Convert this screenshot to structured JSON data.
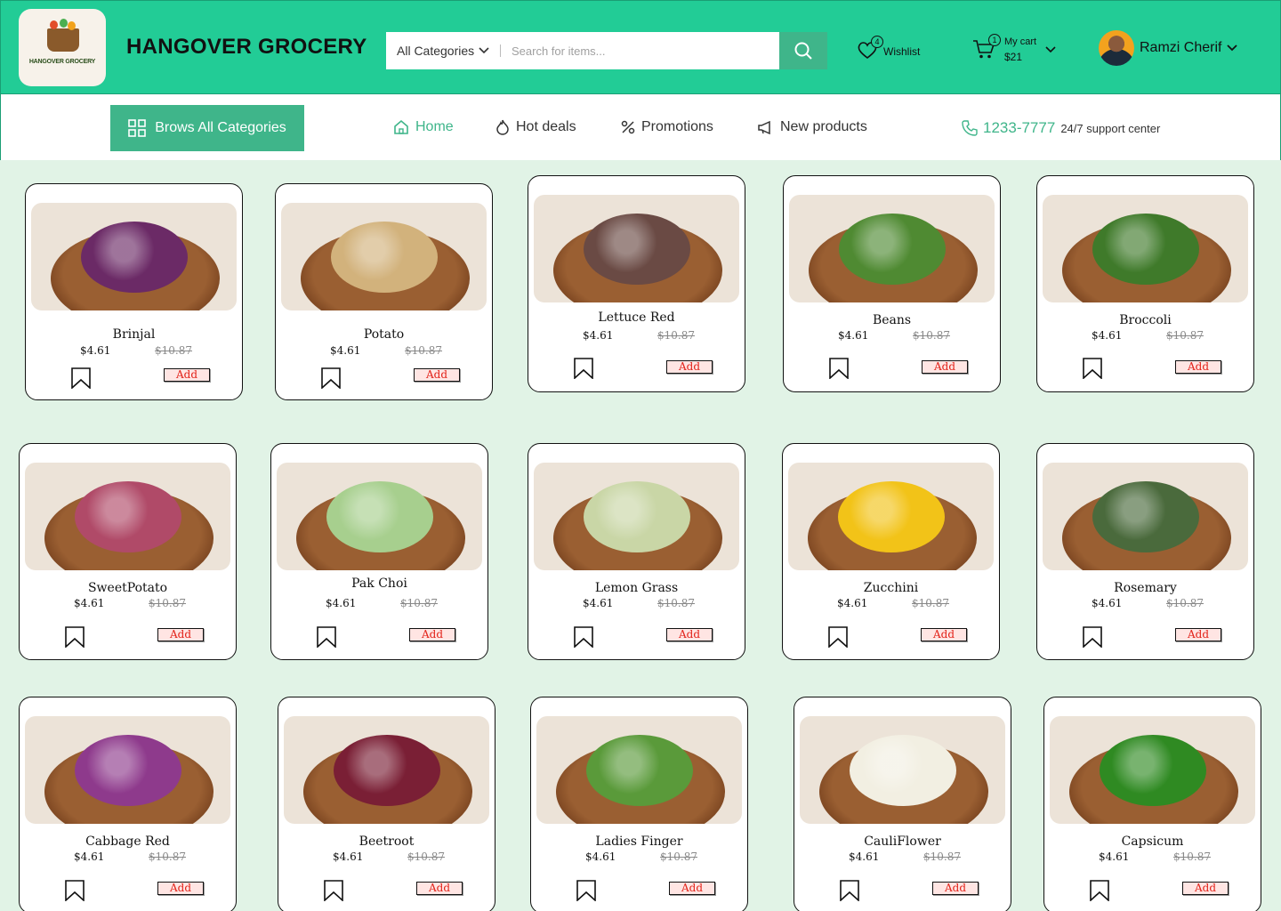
{
  "header": {
    "logo_text": "HANGOVER GROCERY",
    "brand": "HANGOVER GROCERY",
    "search": {
      "category": "All Categories",
      "placeholder": "Search for items..."
    },
    "wishlist": {
      "label": "Wishlist",
      "count": "4"
    },
    "cart": {
      "label": "My cart",
      "total": "$21",
      "count": "1"
    },
    "user": {
      "name": "Ramzi Cherif"
    }
  },
  "nav": {
    "browse": "Brows All Categories",
    "items": [
      "Home",
      "Hot deals",
      "Promotions",
      "New products"
    ],
    "phone": "1233-7777",
    "support": "24/7 support center"
  },
  "colors": {
    "primary": "#22cc96",
    "accent": "#3fb58a",
    "background": "#e1f3e6",
    "add_text": "#e2231a"
  },
  "products": [
    {
      "name": "Brinjal",
      "price": "$4.61",
      "old_price": "$10.87",
      "add": "Add",
      "color": "#6b2a66"
    },
    {
      "name": "Potato",
      "price": "$4.61",
      "old_price": "$10.87",
      "add": "Add",
      "color": "#d2b27c"
    },
    {
      "name": "Lettuce Red",
      "price": "$4.61",
      "old_price": "$10.87",
      "add": "Add",
      "color": "#6a4a44"
    },
    {
      "name": "Beans",
      "price": "$4.61",
      "old_price": "$10.87",
      "add": "Add",
      "color": "#4f8a32"
    },
    {
      "name": "Broccoli",
      "price": "$4.61",
      "old_price": "$10.87",
      "add": "Add",
      "color": "#3f7a2a"
    },
    {
      "name": "SweetPotato",
      "price": "$4.61",
      "old_price": "$10.87",
      "add": "Add",
      "color": "#b04a68"
    },
    {
      "name": "Pak Choi",
      "price": "$4.61",
      "old_price": "$10.87",
      "add": "Add",
      "color": "#a7cf8e"
    },
    {
      "name": "Lemon Grass",
      "price": "$4.61",
      "old_price": "$10.87",
      "add": "Add",
      "color": "#c9d6a6"
    },
    {
      "name": "Zucchini",
      "price": "$4.61",
      "old_price": "$10.87",
      "add": "Add",
      "color": "#f2c318"
    },
    {
      "name": "Rosemary",
      "price": "$4.61",
      "old_price": "$10.87",
      "add": "Add",
      "color": "#4a6a3c"
    },
    {
      "name": "Cabbage Red",
      "price": "$4.61",
      "old_price": "$10.87",
      "add": "Add",
      "color": "#8e3a8c"
    },
    {
      "name": "Beetroot",
      "price": "$4.61",
      "old_price": "$10.87",
      "add": "Add",
      "color": "#7a1f35"
    },
    {
      "name": "Ladies Finger",
      "price": "$4.61",
      "old_price": "$10.87",
      "add": "Add",
      "color": "#5a9a3a"
    },
    {
      "name": "CauliFlower",
      "price": "$4.61",
      "old_price": "$10.87",
      "add": "Add",
      "color": "#f2efe2"
    },
    {
      "name": "Capsicum",
      "price": "$4.61",
      "old_price": "$10.87",
      "add": "Add",
      "color": "#2f8a22"
    }
  ]
}
